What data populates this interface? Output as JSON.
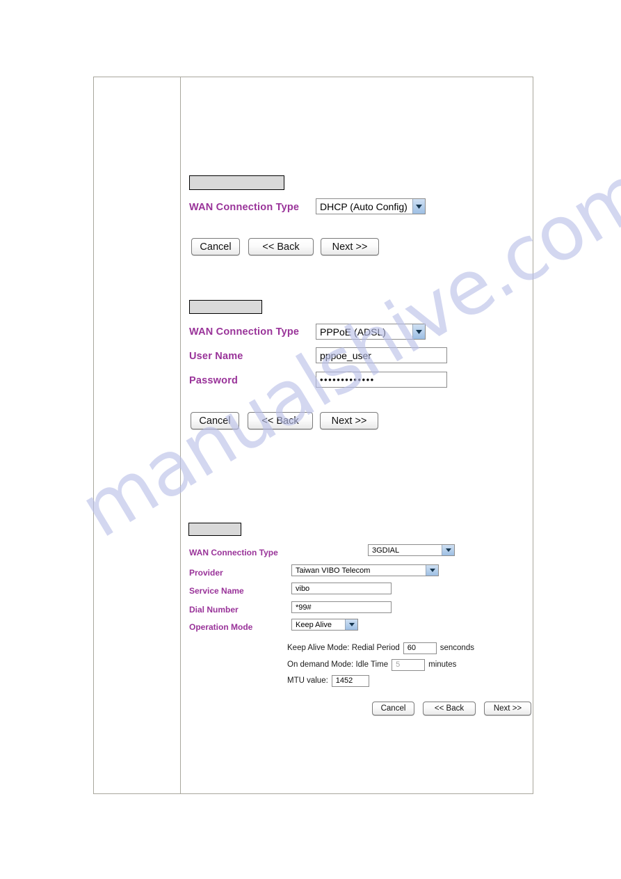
{
  "document": {
    "watermark": "manualshive.com"
  },
  "sections": [
    {
      "id": "dhcp",
      "title_box": "",
      "rows": [
        {
          "label": "WAN Connection Type",
          "control": "select",
          "value": "DHCP (Auto Config)"
        }
      ],
      "buttons": [
        {
          "label": "Cancel"
        },
        {
          "label": "<<  Back"
        },
        {
          "label": "Next  >>"
        }
      ]
    },
    {
      "id": "pppoe",
      "title_box": "",
      "rows": [
        {
          "label": "WAN Connection Type",
          "control": "select",
          "value": "PPPoE (ADSL)"
        },
        {
          "label": "User Name",
          "control": "text",
          "value": "pppoe_user"
        },
        {
          "label": "Password",
          "control": "password",
          "value": "•••••••••••••"
        }
      ],
      "buttons": [
        {
          "label": "Cancel"
        },
        {
          "label": "<<  Back"
        },
        {
          "label": "Next  >>"
        }
      ]
    },
    {
      "id": "3gdial",
      "title_box": "",
      "rows": [
        {
          "label": "WAN Connection Type",
          "control": "select",
          "value": "3GDIAL"
        },
        {
          "label": "Provider",
          "control": "select",
          "value": "Taiwan VIBO Telecom"
        },
        {
          "label": "Service Name",
          "control": "text",
          "value": "vibo"
        },
        {
          "label": "Dial Number",
          "control": "text",
          "value": "*99#"
        },
        {
          "label": "Operation Mode",
          "control": "select",
          "value": "Keep Alive"
        }
      ],
      "notes": {
        "keep_alive_prefix": "Keep Alive Mode: Redial Period",
        "keep_alive_value": "60",
        "keep_alive_suffix": "senconds",
        "on_demand_prefix": "On demand Mode: Idle Time",
        "on_demand_value": "5",
        "on_demand_suffix": "minutes",
        "mtu_prefix": "MTU value:",
        "mtu_value": "1452"
      },
      "buttons": [
        {
          "label": "Cancel"
        },
        {
          "label": "<<  Back"
        },
        {
          "label": "Next  >>"
        }
      ]
    }
  ],
  "icons": {
    "dropdown_arrow": "▼"
  },
  "colors": {
    "label": "#993399",
    "title_box": "#d9d9d9",
    "watermark": "#b9bfe8"
  }
}
